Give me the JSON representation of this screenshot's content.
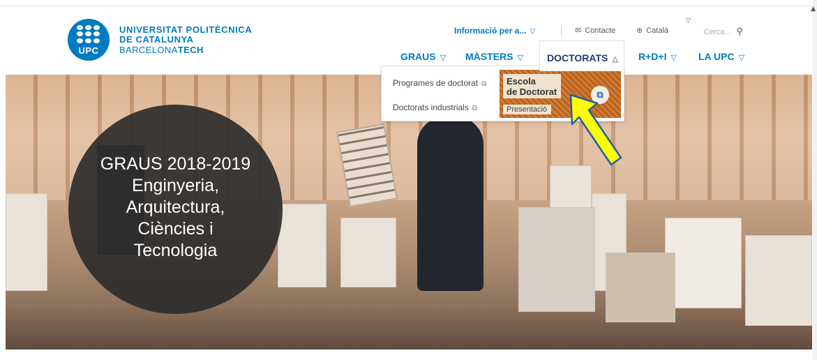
{
  "brand": {
    "mark": "UPC",
    "line1": "UNIVERSITAT POLITÈCNICA",
    "line2": "DE CATALUNYA",
    "line3_regular": "BARCELONA",
    "line3_bold": "TECH",
    "color": "#007bc0"
  },
  "utility": {
    "info_label": "Informació per a...",
    "info_icon": "person-icon",
    "contact_label": "Contacte",
    "contact_icon": "envelope-icon",
    "language_label": "Català",
    "language_icon": "globe-icon",
    "search_placeholder": "Cerca...",
    "search_icon": "search-icon"
  },
  "nav": {
    "items": [
      {
        "label": "GRAUS"
      },
      {
        "label": "MÀSTERS"
      },
      {
        "label": "DOCTORATS",
        "active": true
      },
      {
        "label": "R+D+I"
      },
      {
        "label": "LA UPC"
      }
    ]
  },
  "dropdown": {
    "links": [
      {
        "label": "Programes de doctorat",
        "icon": "external-link-icon"
      },
      {
        "label": "Doctorats industrials",
        "icon": "external-link-icon"
      }
    ],
    "featured": {
      "title_line1": "Escola",
      "title_line2": "de Doctorat",
      "subtitle": "Presentació",
      "icon": "external-link-icon",
      "accent": "#c96a1e"
    }
  },
  "hero": {
    "lines": [
      "GRAUS 2018-2019",
      "Enginyeria,",
      "Arquitectura,",
      "Ciències i",
      "Tecnologia"
    ]
  },
  "annotation": {
    "arrow_color": "#ffff00",
    "arrow_outline": "#1f5fa8"
  }
}
